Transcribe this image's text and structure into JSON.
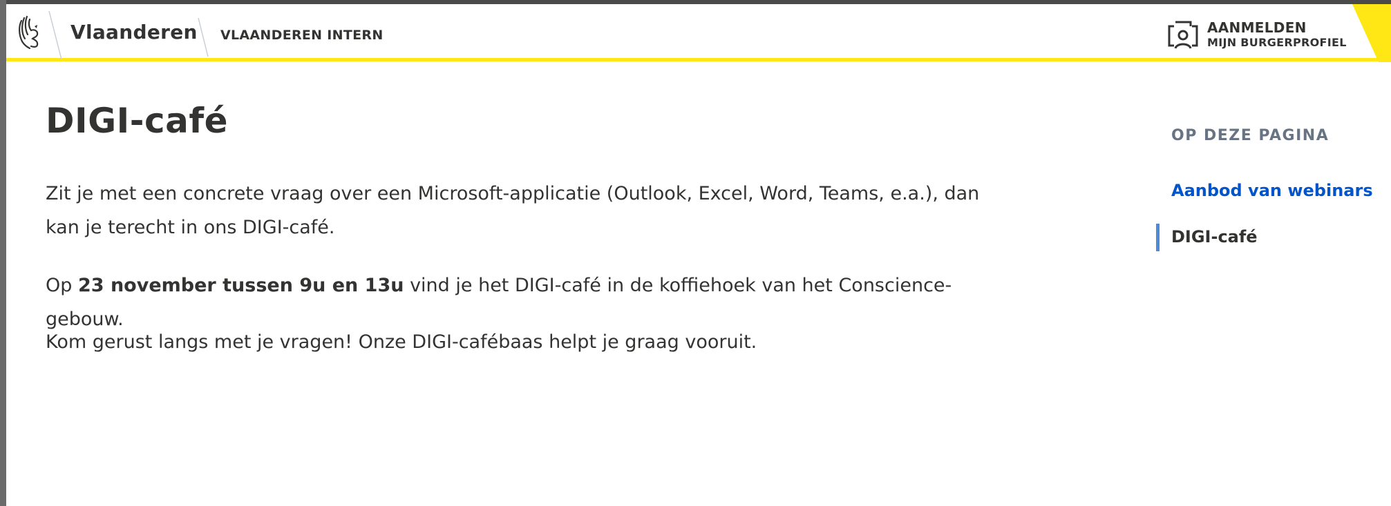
{
  "header": {
    "brand": "Vlaanderen",
    "section": "VLAANDEREN INTERN",
    "login": {
      "title": "AANMELDEN",
      "subtitle": "MIJN BURGERPROFIEL"
    }
  },
  "main": {
    "title": "DIGI-café",
    "paragraphs": {
      "p1_line1": "Zit je met een concrete vraag over een Microsoft-applicatie (Outlook, Excel, Word, Teams, e.a.), dan",
      "p1_line2": "kan je terecht in ons DIGI-café.",
      "p2_prefix": "Op ",
      "p2_bold": "23 november tussen 9u en 13u",
      "p2_suffix": " vind je het DIGI-café in de koffiehoek van het Conscience-gebouw.",
      "p3": "Kom gerust langs met je vragen! Onze DIGI-cafébaas helpt je graag vooruit."
    }
  },
  "sidebar": {
    "title": "OP DEZE PAGINA",
    "items": [
      {
        "label": "Aanbod van webinars",
        "state": "link"
      },
      {
        "label": "DIGI-café",
        "state": "active"
      }
    ]
  },
  "colors": {
    "accent_yellow": "#ffe615",
    "link_blue": "#0055cc",
    "active_marker": "#4f8ad5",
    "text": "#333332",
    "muted": "#687483"
  },
  "icons": {
    "logo": "flemish-lion-icon",
    "login": "profile-card-icon"
  }
}
